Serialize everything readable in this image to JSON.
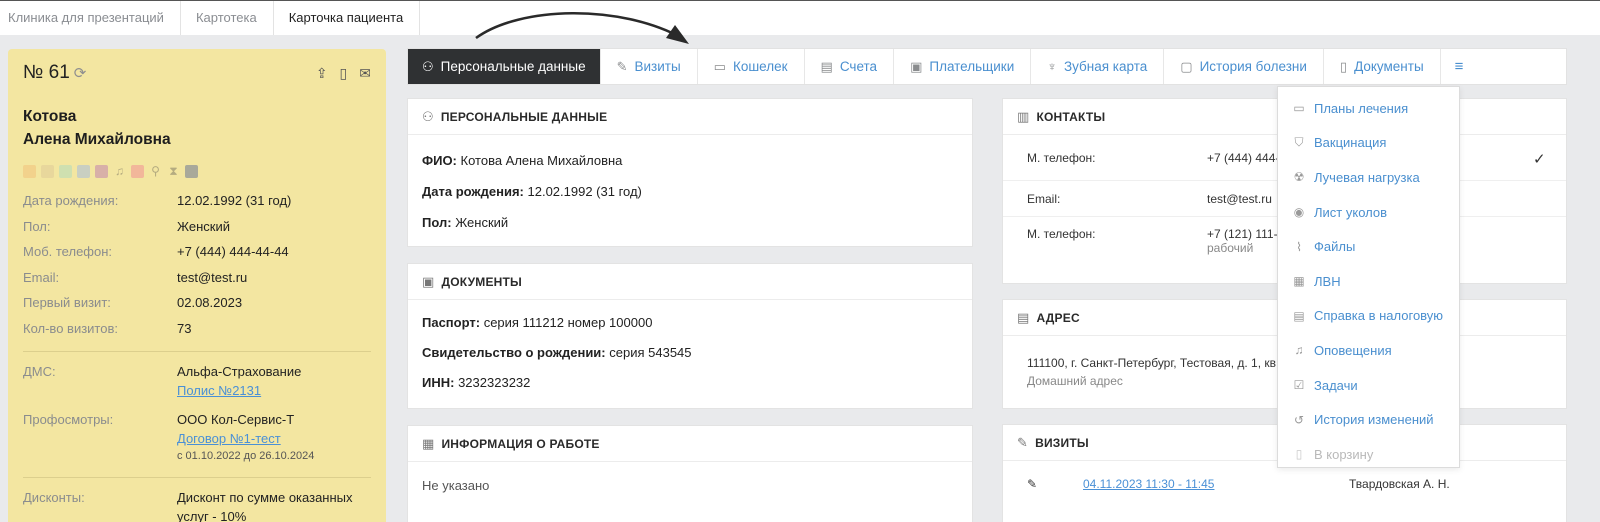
{
  "breadcrumbs": [
    "Клиника для презентаций",
    "Картотека",
    "Карточка пациента"
  ],
  "patient": {
    "number": "№ 61",
    "last_name": "Котова",
    "first_middle": "Алена Михайловна",
    "tag_colors": [
      "#f2d28c",
      "#e8d79c",
      "#cfe0b0",
      "#c9cfc2",
      "#d8b0a8",
      "#f2b79a",
      "#a9a99a"
    ],
    "info": [
      {
        "label": "Дата рождения:",
        "value": "12.02.1992 (31 год)"
      },
      {
        "label": "Пол:",
        "value": "Женский"
      },
      {
        "label": "Моб. телефон:",
        "value": "+7 (444) 444-44-44"
      },
      {
        "label": "Email:",
        "value": "test@test.ru"
      },
      {
        "label": "Первый визит:",
        "value": "02.08.2023"
      },
      {
        "label": "Кол-во визитов:",
        "value": "73"
      }
    ],
    "dms": {
      "label": "ДМС:",
      "value": "Альфа-Страхование",
      "link": "Полис №2131"
    },
    "prof": {
      "label": "Профосмотры:",
      "value": "ООО Кол-Сервис-Т",
      "link": "Договор №1-тест",
      "period": "с 01.10.2022 до 26.10.2024"
    },
    "discounts": {
      "label": "Дисконты:",
      "value": "Дисконт по сумме оказанных услуг - 10%"
    }
  },
  "tabs": [
    {
      "label": "Персональные данные",
      "icon": "user-icon"
    },
    {
      "label": "Визиты",
      "icon": "edit-icon"
    },
    {
      "label": "Кошелек",
      "icon": "wallet-icon"
    },
    {
      "label": "Счета",
      "icon": "invoice-icon"
    },
    {
      "label": "Плательщики",
      "icon": "payer-card-icon"
    },
    {
      "label": "Зубная карта",
      "icon": "tooth-icon"
    },
    {
      "label": "История болезни",
      "icon": "clipboard-icon"
    },
    {
      "label": "Документы",
      "icon": "document-icon"
    }
  ],
  "personal": {
    "title": "ПЕРСОНАЛЬНЫЕ ДАННЫЕ",
    "fio_label": "ФИО:",
    "fio": "Котова Алена Михайловна",
    "dob_label": "Дата рождения:",
    "dob": "12.02.1992 (31 год)",
    "sex_label": "Пол:",
    "sex": "Женский"
  },
  "documents": {
    "title": "ДОКУМЕНТЫ",
    "passport_label": "Паспорт:",
    "passport": "серия 111212 номер 100000",
    "birth_label": "Свидетельство о рождении:",
    "birth": "серия 543545",
    "inn_label": "ИНН:",
    "inn": "3232323232"
  },
  "work": {
    "title": "ИНФОРМАЦИЯ О РАБОТЕ",
    "value": "Не указано"
  },
  "contacts": {
    "title": "КОНТАКТЫ",
    "rows": [
      {
        "label": "М. телефон:",
        "value": "+7 (444) 444-",
        "sub": ""
      },
      {
        "label": "Email:",
        "value": "test@test.ru",
        "sub": ""
      },
      {
        "label": "М. телефон:",
        "value": "+7 (121) 111-11-",
        "sub": "рабочий"
      }
    ]
  },
  "address": {
    "title": "АДРЕС",
    "value": "111100, г. Санкт-Петербург, Тестовая, д. 1, кв. 1",
    "type": "Домашний адрес"
  },
  "visits": {
    "title": "ВИЗИТЫ",
    "date": "04.11.2023 11:30 - 11:45",
    "doctor": "Твардовская А. Н."
  },
  "dropdown": [
    {
      "label": "Планы лечения",
      "icon": "plan-icon"
    },
    {
      "label": "Вакцинация",
      "icon": "shield-icon"
    },
    {
      "label": "Лучевая нагрузка",
      "icon": "radiation-icon"
    },
    {
      "label": "Лист уколов",
      "icon": "eye-icon"
    },
    {
      "label": "Файлы",
      "icon": "paperclip-icon"
    },
    {
      "label": "ЛВН",
      "icon": "calendar-icon"
    },
    {
      "label": "Справка в налоговую",
      "icon": "printer-icon"
    },
    {
      "label": "Оповещения",
      "icon": "bell-icon"
    },
    {
      "label": "Задачи",
      "icon": "checkbox-icon"
    },
    {
      "label": "История изменений",
      "icon": "history-icon"
    },
    {
      "label": "В корзину",
      "icon": "trash-icon"
    }
  ],
  "check": "✓"
}
